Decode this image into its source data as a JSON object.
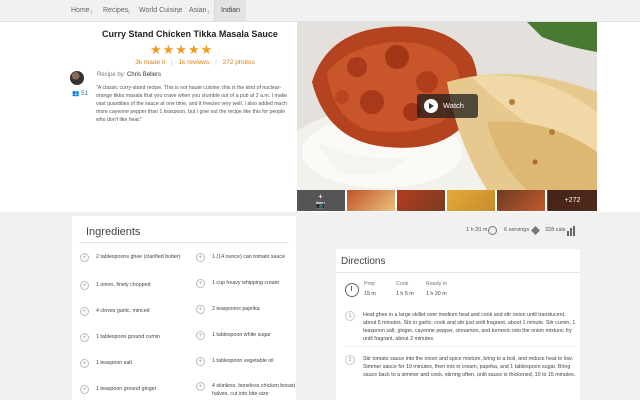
{
  "breadcrumb": [
    "Home",
    "Recipes",
    "World Cuisine",
    "Asian",
    "Indian"
  ],
  "recipe": {
    "title": "Curry Stand Chicken Tikka Masala Sauce",
    "stars": "★★★★★",
    "made_it": "3k made it",
    "reviews": "1k reviews",
    "photos": "272 photos",
    "recipe_by_label": "Recipe by:",
    "author": "Chris Bellers",
    "followers": "51",
    "description": "\"A classic curry-stand recipe. This is not haute cuisine; this is the kind of nuclear-orange tikka masala that you crave when you stumble out of a pub at 2 a.m. I make vast quantities of the sauce at one time, and it freezes very well. I also added much more cayenne pepper than 1 teaspoon, but I give out the recipe like this for people who don't like heat.\""
  },
  "media": {
    "watch_label": "Watch",
    "more_photos": "+272"
  },
  "ingredients": {
    "heading": "Ingredients",
    "left": [
      "2 tablespoons ghee (clarified butter)",
      "1 onion, finely chopped",
      "4 cloves garlic, minced",
      "1 tablespoon ground cumin",
      "1 teaspoon salt",
      "1 teaspoon ground ginger"
    ],
    "right": [
      "1 (14 ounce) can tomato sauce",
      "1 cup heavy whipping cream",
      "2 teaspoons paprika",
      "1 tablespoon white sugar",
      "1 tablespoon vegetable oil",
      "4 skinless, boneless chicken breast halves, cut into bite-size"
    ]
  },
  "meta": {
    "time": "1 h 20 m",
    "servings": "6 servings",
    "calories": "328 cals"
  },
  "directions": {
    "heading": "Directions",
    "prep_label": "Prep",
    "prep_value": "15 m",
    "cook_label": "Cook",
    "cook_value": "1 h 5 m",
    "ready_label": "Ready In",
    "ready_value": "1 h 20 m",
    "steps": [
      {
        "num": "1",
        "text": "Heat ghee in a large skillet over medium heat and cook and stir onion until translucent, about 5 minutes. Stir in garlic; cook and stir just until fragrant, about 1 minute. Stir cumin, 1 teaspoon salt, ginger, cayenne pepper, cinnamon, and turmeric into the onion mixture; fry until fragrant, about 2 minutes."
      },
      {
        "num": "2",
        "text": "Stir tomato sauce into the onion and spice mixture, bring to a boil, and reduce heat to low. Simmer sauce for 10 minutes, then mix in cream, paprika, and 1 tablespoon sugar. Bring sauce back to a simmer and cook, stirring often, until sauce is thickened, 10 to 15 minutes."
      }
    ]
  },
  "colors": {
    "accent": "#f19b21",
    "link": "#2a6fb0"
  }
}
